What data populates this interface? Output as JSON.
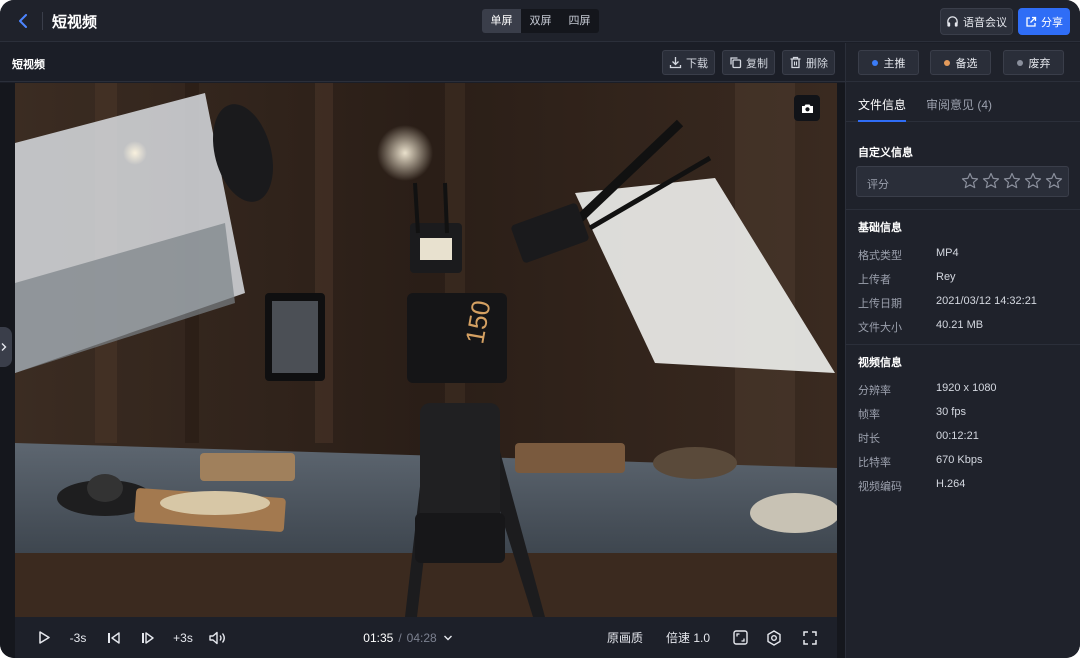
{
  "header": {
    "title": "短视频",
    "layout_options": [
      "单屏",
      "双屏",
      "四屏"
    ],
    "voice_label": "语音会议",
    "share_label": "分享"
  },
  "toolbar": {
    "file_name": "短视频",
    "download_label": "下载",
    "copy_label": "复制",
    "delete_label": "删除"
  },
  "player": {
    "rewind_label": "-3s",
    "forward_label": "+3s",
    "current_time": "01:35",
    "separator": "/",
    "total_time": "04:28",
    "quality_label": "原画质",
    "speed_label": "倍速 1.0"
  },
  "panel": {
    "tags": [
      {
        "label": "主推",
        "color": "#3b7cf7"
      },
      {
        "label": "备选",
        "color": "#e39a5b"
      },
      {
        "label": "废弃",
        "color": "#8a8f9c"
      }
    ],
    "tabs": [
      {
        "label": "文件信息"
      },
      {
        "label": "审阅意见 (4)"
      }
    ],
    "custom_title": "自定义信息",
    "rating_label": "评分",
    "rating_stars": 5,
    "basic_title": "基础信息",
    "basic": [
      {
        "key": "格式类型",
        "value": "MP4"
      },
      {
        "key": "上传者",
        "value": "Rey"
      },
      {
        "key": "上传日期",
        "value": "2021/03/12 14:32:21"
      },
      {
        "key": "文件大小",
        "value": "40.21 MB"
      }
    ],
    "video_title": "视频信息",
    "video": [
      {
        "key": "分辨率",
        "value": "1920 x 1080"
      },
      {
        "key": "帧率",
        "value": "30 fps"
      },
      {
        "key": "时长",
        "value": "00:12:21"
      },
      {
        "key": "比特率",
        "value": "670 Kbps"
      },
      {
        "key": "视频编码",
        "value": "H.264"
      }
    ]
  },
  "colors": {
    "accent": "#2f6df6",
    "background": "#1b1e27"
  }
}
